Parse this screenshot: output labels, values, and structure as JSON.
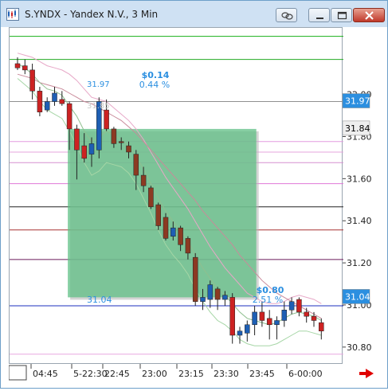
{
  "window": {
    "title": "S.YNDX - Yandex N.V., 3 Min"
  },
  "price_axis": {
    "ticks": [
      {
        "value": 32.0,
        "label": "32.00"
      },
      {
        "value": 31.8,
        "label": "31.80"
      },
      {
        "value": 31.6,
        "label": "31.60"
      },
      {
        "value": 31.4,
        "label": "31.40"
      },
      {
        "value": 31.2,
        "label": "31.20"
      },
      {
        "value": 31.0,
        "label": "31.00"
      },
      {
        "value": 30.8,
        "label": "30.80"
      }
    ],
    "markers": [
      {
        "value": 31.97,
        "label": "31.97",
        "bg": "#2b8fe0",
        "fg": "#ffffff"
      },
      {
        "value": 31.84,
        "label": "31.84",
        "bg": "#eeeeee",
        "fg": "#000000"
      },
      {
        "value": 31.04,
        "label": "31.04",
        "bg": "#2b8fe0",
        "fg": "#ffffff"
      }
    ],
    "range": [
      30.72,
      32.32
    ]
  },
  "time_axis": {
    "labels": [
      "04:45",
      "5-22:30",
      "22:45",
      "23:00",
      "23:15",
      "23:30",
      "23:45",
      "6-00:00"
    ]
  },
  "annotations": {
    "top_change": "$0.14",
    "top_pct": "0.44 %",
    "top_left_price": "31.97",
    "ghost_price": "31.85",
    "bottom_change": "$0.80",
    "bottom_pct": "2.51 %",
    "bottom_left_price": "31.04"
  },
  "colors": {
    "bull": "#1e5fb4",
    "bear": "#cc2222",
    "bear_dark": "#8c3a22",
    "zone_fill": "#5fbf84",
    "marker_blue": "#2b8fe0",
    "green_line": "#1aa41a"
  },
  "chart_data": {
    "type": "candlestick",
    "title": "S.YNDX - Yandex N.V., 3 Min",
    "ylim": [
      30.72,
      32.32
    ],
    "candles": [
      {
        "o": 32.15,
        "h": 32.18,
        "l": 32.12,
        "c": 32.13,
        "dir": "down"
      },
      {
        "o": 32.14,
        "h": 32.17,
        "l": 32.1,
        "c": 32.12,
        "dir": "down"
      },
      {
        "o": 32.12,
        "h": 32.15,
        "l": 31.98,
        "c": 32.02,
        "dir": "down"
      },
      {
        "o": 32.02,
        "h": 32.04,
        "l": 31.9,
        "c": 31.92,
        "dir": "down"
      },
      {
        "o": 31.93,
        "h": 31.99,
        "l": 31.92,
        "c": 31.97,
        "dir": "up"
      },
      {
        "o": 31.97,
        "h": 32.04,
        "l": 31.95,
        "c": 32.01,
        "dir": "up"
      },
      {
        "o": 31.98,
        "h": 32.02,
        "l": 31.95,
        "c": 31.96,
        "dir": "down"
      },
      {
        "o": 31.96,
        "h": 31.97,
        "l": 31.74,
        "c": 31.84,
        "dir": "down"
      },
      {
        "o": 31.84,
        "h": 31.86,
        "l": 31.6,
        "c": 31.74,
        "dir": "down"
      },
      {
        "o": 31.76,
        "h": 31.82,
        "l": 31.68,
        "c": 31.7,
        "dir": "down"
      },
      {
        "o": 31.72,
        "h": 31.8,
        "l": 31.66,
        "c": 31.77,
        "dir": "up"
      },
      {
        "o": 31.74,
        "h": 31.99,
        "l": 31.7,
        "c": 31.97,
        "dir": "up"
      },
      {
        "o": 31.93,
        "h": 31.98,
        "l": 31.83,
        "c": 31.84,
        "dir": "down"
      },
      {
        "o": 31.84,
        "h": 31.85,
        "l": 31.75,
        "c": 31.77,
        "dir": "down"
      },
      {
        "o": 31.78,
        "h": 31.8,
        "l": 31.74,
        "c": 31.78,
        "dir": "down"
      },
      {
        "o": 31.76,
        "h": 31.78,
        "l": 31.7,
        "c": 31.73,
        "dir": "down"
      },
      {
        "o": 31.72,
        "h": 31.74,
        "l": 31.55,
        "c": 31.62,
        "dir": "down"
      },
      {
        "o": 31.62,
        "h": 31.66,
        "l": 31.54,
        "c": 31.57,
        "dir": "down"
      },
      {
        "o": 31.56,
        "h": 31.57,
        "l": 31.46,
        "c": 31.47,
        "dir": "down"
      },
      {
        "o": 31.48,
        "h": 31.49,
        "l": 31.36,
        "c": 31.38,
        "dir": "down"
      },
      {
        "o": 31.42,
        "h": 31.44,
        "l": 31.31,
        "c": 31.32,
        "dir": "down"
      },
      {
        "o": 31.33,
        "h": 31.4,
        "l": 31.31,
        "c": 31.37,
        "dir": "up"
      },
      {
        "o": 31.37,
        "h": 31.38,
        "l": 31.26,
        "c": 31.29,
        "dir": "down"
      },
      {
        "o": 31.32,
        "h": 31.33,
        "l": 31.22,
        "c": 31.25,
        "dir": "down"
      },
      {
        "o": 31.23,
        "h": 31.25,
        "l": 31.0,
        "c": 31.02,
        "dir": "down"
      },
      {
        "o": 31.02,
        "h": 31.08,
        "l": 30.98,
        "c": 31.04,
        "dir": "up"
      },
      {
        "o": 31.03,
        "h": 31.12,
        "l": 30.99,
        "c": 31.1,
        "dir": "up"
      },
      {
        "o": 31.08,
        "h": 31.09,
        "l": 30.98,
        "c": 31.03,
        "dir": "down"
      },
      {
        "o": 31.03,
        "h": 31.07,
        "l": 31.0,
        "c": 31.05,
        "dir": "up"
      },
      {
        "o": 31.04,
        "h": 31.06,
        "l": 30.82,
        "c": 30.86,
        "dir": "down"
      },
      {
        "o": 30.86,
        "h": 30.9,
        "l": 30.82,
        "c": 30.88,
        "dir": "up"
      },
      {
        "o": 30.87,
        "h": 30.93,
        "l": 30.83,
        "c": 30.91,
        "dir": "up"
      },
      {
        "o": 30.91,
        "h": 31.0,
        "l": 30.86,
        "c": 30.97,
        "dir": "up"
      },
      {
        "o": 30.97,
        "h": 31.02,
        "l": 30.9,
        "c": 30.93,
        "dir": "down"
      },
      {
        "o": 30.94,
        "h": 30.98,
        "l": 30.84,
        "c": 30.91,
        "dir": "down"
      },
      {
        "o": 30.91,
        "h": 30.95,
        "l": 30.84,
        "c": 30.93,
        "dir": "up"
      },
      {
        "o": 30.93,
        "h": 31.02,
        "l": 30.9,
        "c": 30.98,
        "dir": "up"
      },
      {
        "o": 30.98,
        "h": 31.04,
        "l": 30.96,
        "c": 31.02,
        "dir": "up"
      },
      {
        "o": 31.03,
        "h": 31.04,
        "l": 30.95,
        "c": 30.97,
        "dir": "down"
      },
      {
        "o": 30.97,
        "h": 30.99,
        "l": 30.92,
        "c": 30.95,
        "dir": "down"
      },
      {
        "o": 30.95,
        "h": 30.97,
        "l": 30.9,
        "c": 30.93,
        "dir": "down"
      },
      {
        "o": 30.92,
        "h": 30.94,
        "l": 30.84,
        "c": 30.88,
        "dir": "down"
      }
    ],
    "hlines": [
      {
        "value": 32.28,
        "color": "#16b016"
      },
      {
        "value": 32.17,
        "color": "#22aa22"
      },
      {
        "value": 31.97,
        "color": "#909090"
      },
      {
        "value": 31.78,
        "color": "#e39be0"
      },
      {
        "value": 31.73,
        "color": "#e6a4de"
      },
      {
        "value": 31.68,
        "color": "#d58fd0"
      },
      {
        "value": 31.58,
        "color": "#e078d8"
      },
      {
        "value": 31.47,
        "color": "#222222"
      },
      {
        "value": 31.36,
        "color": "#a83232"
      },
      {
        "value": 31.22,
        "color": "#6a1a5a"
      },
      {
        "value": 31.0,
        "color": "#1c2fbf"
      },
      {
        "value": 30.77,
        "color": "#e7a7e0"
      }
    ],
    "zone": {
      "top": 31.84,
      "bottom": 31.04,
      "start_index": 7,
      "end_index": 29
    },
    "ma_slow": [
      32.1,
      32.09,
      32.08,
      32.06,
      32.05,
      32.04,
      32.03,
      32.01,
      31.99,
      31.97,
      31.96,
      31.94,
      31.92,
      31.9,
      31.88,
      31.85,
      31.82,
      31.78,
      31.74,
      31.7,
      31.66,
      31.62,
      31.58,
      31.54,
      31.5,
      31.45,
      31.41,
      31.37,
      31.33,
      31.29,
      31.24,
      31.2,
      31.16,
      31.12,
      31.09,
      31.06,
      31.04,
      31.02,
      31.0,
      30.98,
      30.96,
      30.94
    ],
    "ma_fast": [
      32.15,
      32.13,
      32.1,
      32.06,
      32.03,
      32.02,
      32.0,
      31.95,
      31.9,
      31.83,
      31.78,
      31.8,
      31.83,
      31.81,
      31.79,
      31.76,
      31.71,
      31.65,
      31.58,
      31.51,
      31.45,
      31.4,
      31.36,
      31.31,
      31.24,
      31.18,
      31.13,
      31.08,
      31.05,
      31.01,
      30.97,
      30.94,
      30.93,
      30.92,
      30.91,
      30.92,
      30.94,
      30.96,
      30.97,
      30.96,
      30.95,
      30.93
    ],
    "band_upper": [
      32.2,
      32.19,
      32.18,
      32.16,
      32.14,
      32.13,
      32.12,
      32.1,
      32.07,
      32.03,
      31.99,
      31.98,
      31.97,
      31.94,
      31.91,
      31.88,
      31.84,
      31.79,
      31.73,
      31.67,
      31.61,
      31.56,
      31.51,
      31.46,
      31.4,
      31.34,
      31.28,
      31.23,
      31.18,
      31.14,
      31.1,
      31.06,
      31.04,
      31.02,
      31.01,
      31.01,
      31.02,
      31.04,
      31.05,
      31.04,
      31.03,
      31.01
    ],
    "band_lower": [
      32.08,
      32.05,
      32.02,
      31.97,
      31.93,
      31.91,
      31.89,
      31.83,
      31.76,
      31.68,
      31.62,
      31.64,
      31.68,
      31.67,
      31.66,
      31.63,
      31.58,
      31.51,
      31.44,
      31.36,
      31.29,
      31.24,
      31.2,
      31.15,
      31.08,
      31.02,
      30.97,
      30.93,
      30.91,
      30.88,
      30.84,
      30.82,
      30.81,
      30.81,
      30.81,
      30.82,
      30.84,
      30.86,
      30.88,
      30.88,
      30.87,
      30.86
    ]
  }
}
